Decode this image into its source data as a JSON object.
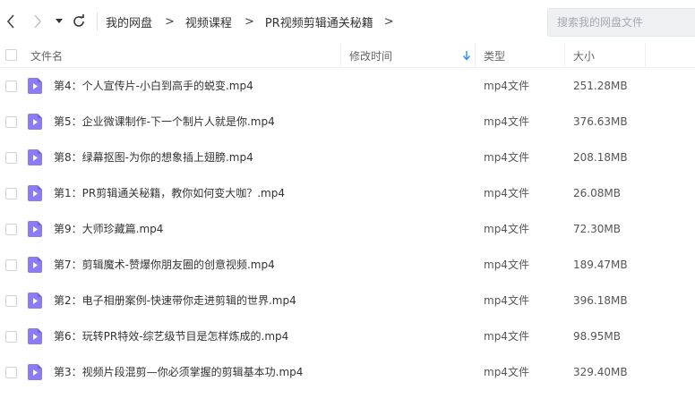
{
  "breadcrumb": [
    "我的网盘",
    "视频课程",
    "PR视频剪辑通关秘籍"
  ],
  "search": {
    "placeholder": "搜索我的网盘文件"
  },
  "columns": {
    "name": "文件名",
    "modified": "修改时间",
    "type": "类型",
    "size": "大小"
  },
  "colors": {
    "icon_accent": "#8b7cf6",
    "icon_dark": "#6c5fe0"
  },
  "files": [
    {
      "name": "第4：个人宣传片-小白到高手的蜕变.mp4",
      "type": "mp4文件",
      "size": "251.28MB"
    },
    {
      "name": "第5：企业微课制作-下一个制片人就是你.mp4",
      "type": "mp4文件",
      "size": "376.63MB"
    },
    {
      "name": "第8：绿幕抠图-为你的想象插上翅膀.mp4",
      "type": "mp4文件",
      "size": "208.18MB"
    },
    {
      "name": "第1：PR剪辑通关秘籍，教你如何变大咖？.mp4",
      "type": "mp4文件",
      "size": "26.08MB"
    },
    {
      "name": "第9：大师珍藏篇.mp4",
      "type": "mp4文件",
      "size": "72.30MB"
    },
    {
      "name": "第7：剪辑魔术-赞爆你朋友圈的创意视频.mp4",
      "type": "mp4文件",
      "size": "189.47MB"
    },
    {
      "name": "第2：电子相册案例-快速带你走进剪辑的世界.mp4",
      "type": "mp4文件",
      "size": "396.18MB"
    },
    {
      "name": "第6：玩转PR特效-综艺级节目是怎样炼成的.mp4",
      "type": "mp4文件",
      "size": "98.95MB"
    },
    {
      "name": "第3：视频片段混剪—你必须掌握的剪辑基本功.mp4",
      "type": "mp4文件",
      "size": "329.40MB"
    }
  ]
}
